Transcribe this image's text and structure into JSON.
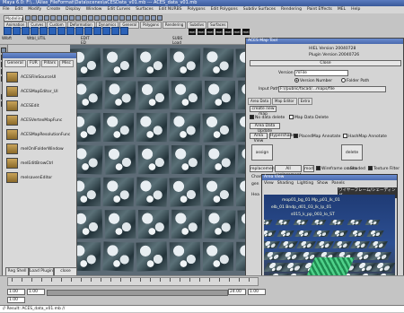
{
  "window": {
    "title": "Maya 6.0: F:\\...\\Alias_FileFormat\\Data\\scenes\\aCESData_v01.mb --- ACES_data_v01.mb"
  },
  "menubar": [
    "File",
    "Edit",
    "Modify",
    "Create",
    "Display",
    "Window",
    "Edit Curves",
    "Surfaces",
    "Edit NURBS",
    "Polygons",
    "Edit Polygons",
    "Subdiv Surfaces",
    "Rendering",
    "Paint Effects",
    "MEL",
    "Help"
  ],
  "shelf": {
    "mode": "Modeling",
    "tabs": [
      "Animation",
      "Curves",
      "Custom",
      "Deformation",
      "Dynamics",
      "General",
      "Polygons",
      "Rendering",
      "Subdivs",
      "Surfaces"
    ],
    "labels": [
      "Wlbft",
      "Wtbl_UTIL",
      "EDIT ED",
      "SUBS Load",
      "mel",
      "mel",
      "mel",
      "mel",
      "mel",
      "mel",
      "mel"
    ]
  },
  "outliner": {
    "title": "",
    "tabs": [
      "General",
      "FUR",
      "Pillars",
      "Misc"
    ],
    "items": [
      "ACESFileSourceUI",
      "ACESMapEditor_UI",
      "ACESEdit",
      "ACESVertexMapFunc",
      "ACESMapResolutionFunc",
      "melOnlFolderWindow",
      "melEditBrowCtrl",
      "melsavenEditor"
    ],
    "buttons": [
      "Reg Shell",
      "Load Plugin",
      "close"
    ]
  },
  "aces": {
    "title": "ACES Map Tool",
    "version": "HIEL Version 20040728",
    "plugin_version": "Plugin Version 20040726",
    "close": "Close",
    "version_label": "Version",
    "version_value": "mFile",
    "radio_number": "Version Number",
    "radio_folder": "Folder Path",
    "input_path_label": "Input Path",
    "input_path_value": "F:\\/public/facad/...maps/file",
    "tabs": [
      "Area Data",
      "Map Editor",
      "Extra"
    ],
    "btn_new": "create new map",
    "chk_nodata": "No data delete",
    "chk_mapdel": "Map Data Delete",
    "btn_update": "Area Data Update",
    "btn_areaview": "Area View",
    "btn_hypershade": "Hypershade",
    "chk_placement": "PlacedMap Annotate",
    "chk_hashmap": "HashMap Annotate",
    "btn_assign": "assign area",
    "btn_delete": "delete area",
    "btn_replacement": "replacement",
    "btn_allreplace": "All replacement",
    "btn_mod": "mod",
    "chk_wireframe": "Wireframe on Shaded",
    "chk_texture": "Texture Filter",
    "section": "Channel Switch",
    "row_a": "gen",
    "row_b": "Hea"
  },
  "renderwin": {
    "title": "Area View",
    "menu": [
      "View",
      "Shading",
      "Lighting",
      "Show",
      "Panels"
    ],
    "overlay": "ワイヤーフレーム/シェーディング",
    "label1": "mop01_bg_01 Mp_p01_lk_01",
    "label2": "elb_01 Bndp_d01_03_lk_lp_01",
    "label3": "s015_k_pp_003_lo_ST",
    "corner": "ACES_sceneElements"
  },
  "timeline": {
    "start": "1.00",
    "end": "1.00",
    "range_start": "1.00",
    "range_end": "24.00",
    "current": "1.00"
  },
  "commandline": "// Result: ACES_data_v01.mb //"
}
